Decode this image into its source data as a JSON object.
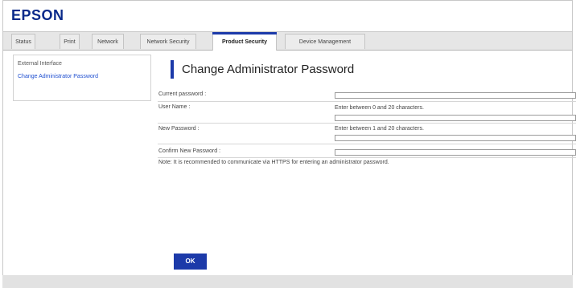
{
  "brand": {
    "logo": "EPSON"
  },
  "tabs": [
    {
      "label": "Status"
    },
    {
      "label": "Print"
    },
    {
      "label": "Network"
    },
    {
      "label": "Network Security"
    },
    {
      "label": "Product Security",
      "active": true
    },
    {
      "label": "Device Management"
    }
  ],
  "sidebar": {
    "items": [
      {
        "label": "External Interface"
      },
      {
        "label": "Change Administrator Password",
        "selected": true
      }
    ]
  },
  "main": {
    "title": "Change Administrator Password",
    "fields": {
      "current_password": {
        "label": "Current password :",
        "value": ""
      },
      "user_name": {
        "label": "User Name :",
        "hint": "Enter between 0 and 20 characters.",
        "value": ""
      },
      "new_password": {
        "label": "New Password :",
        "hint": "Enter between 1 and 20 characters.",
        "value": ""
      },
      "confirm_password": {
        "label": "Confirm New Password :",
        "value": ""
      }
    },
    "note": "Note: It is recommended to communicate via HTTPS for entering an administrator password.",
    "ok_label": "OK"
  },
  "colors": {
    "accent": "#1c3aa9",
    "link": "#1f4fd0",
    "brand": "#0a2a8a"
  }
}
